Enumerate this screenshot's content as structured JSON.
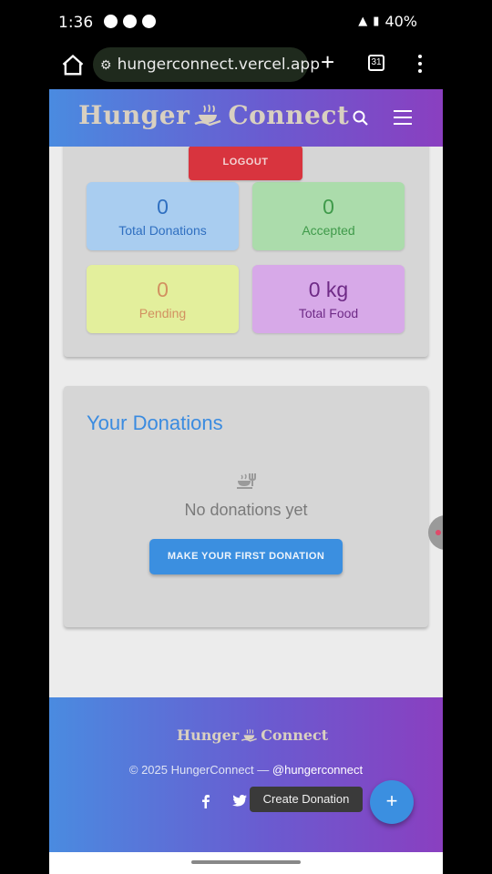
{
  "status_bar": {
    "time": "1:36",
    "battery": "40%"
  },
  "browser": {
    "url": "hungerconnect.vercel.app",
    "tab_count": "31"
  },
  "header": {
    "logo_left": "Hunger",
    "logo_right": "Connect"
  },
  "stats": {
    "logout_label": "LOGOUT",
    "items": [
      {
        "value": "0",
        "label": "Total Donations"
      },
      {
        "value": "0",
        "label": "Accepted"
      },
      {
        "value": "0",
        "label": "Pending"
      },
      {
        "value": "0 kg",
        "label": "Total Food"
      }
    ]
  },
  "donations": {
    "title": "Your Donations",
    "empty_text": "No donations yet",
    "cta_label": "MAKE YOUR FIRST DONATION"
  },
  "footer": {
    "logo_left": "Hunger",
    "logo_right": "Connect",
    "copyright": "© 2025 HungerConnect — ",
    "handle": "@hungerconnect",
    "tooltip": "Create Donation",
    "fab_label": "+"
  },
  "icons": [
    "home-icon",
    "site-settings-icon",
    "new-tab-icon",
    "tabs-icon",
    "more-menu-icon",
    "search-icon",
    "hamburger-icon",
    "food-icon",
    "facebook-icon",
    "twitter-icon"
  ],
  "colors": {
    "header_gradient_start": "#4a8be0",
    "header_gradient_end": "#8a3fc0",
    "logout": "#d8343e",
    "primary": "#3b8fe0"
  }
}
